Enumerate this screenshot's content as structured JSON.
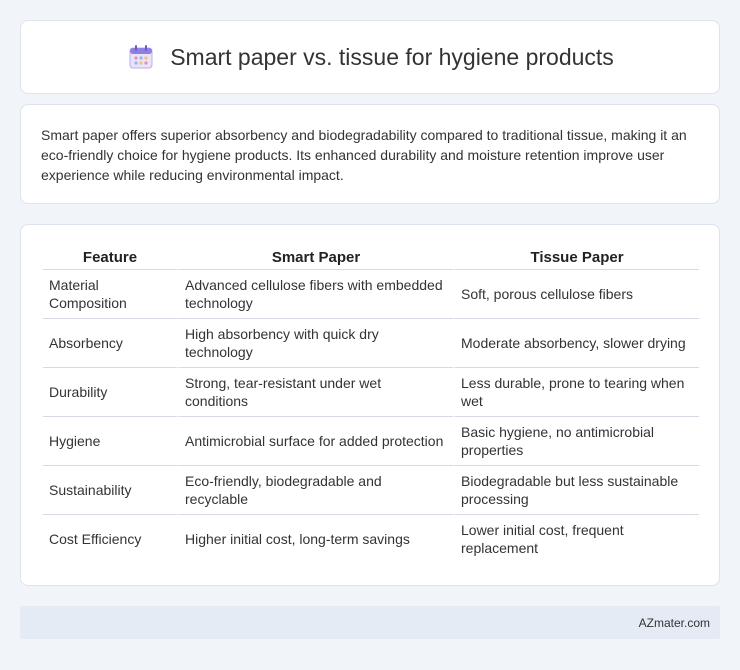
{
  "header": {
    "title": "Smart paper vs. tissue for hygiene products",
    "icon": "calendar-icon"
  },
  "summary": {
    "text": "Smart paper offers superior absorbency and biodegradability compared to traditional tissue, making it an eco-friendly choice for hygiene products. Its enhanced durability and moisture retention improve user experience while reducing environmental impact."
  },
  "table": {
    "headers": [
      "Feature",
      "Smart Paper",
      "Tissue Paper"
    ],
    "rows": [
      [
        "Material Composition",
        "Advanced cellulose fibers with embedded technology",
        "Soft, porous cellulose fibers"
      ],
      [
        "Absorbency",
        "High absorbency with quick dry technology",
        "Moderate absorbency, slower drying"
      ],
      [
        "Durability",
        "Strong, tear-resistant under wet conditions",
        "Less durable, prone to tearing when wet"
      ],
      [
        "Hygiene",
        "Antimicrobial surface for added protection",
        "Basic hygiene, no antimicrobial properties"
      ],
      [
        "Sustainability",
        "Eco-friendly, biodegradable and recyclable",
        "Biodegradable but less sustainable processing"
      ],
      [
        "Cost Efficiency",
        "Higher initial cost, long-term savings",
        "Lower initial cost, frequent replacement"
      ]
    ]
  },
  "footer": {
    "text": "AZmater.com"
  }
}
